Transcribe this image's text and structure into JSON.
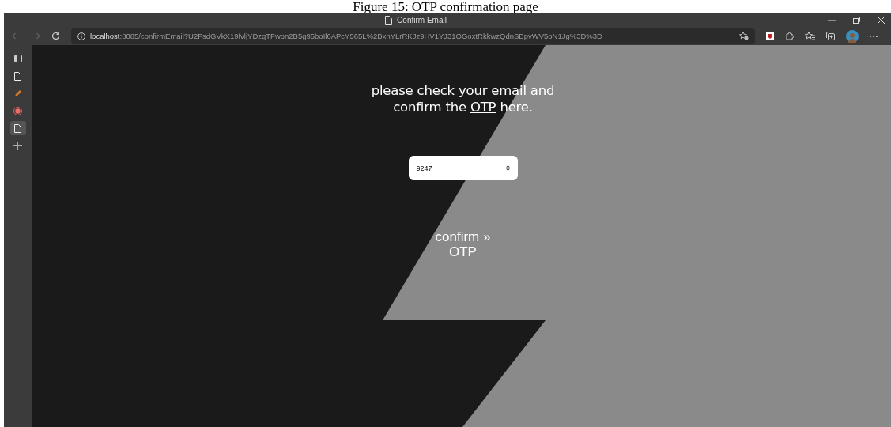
{
  "caption": "Figure 15: OTP confirmation page",
  "window": {
    "title": "Confirm Email"
  },
  "address_bar": {
    "host": "localhost",
    "path": ":8085/confirmEmail?U2FsdGVkX19fvljYDzqTFwon2B5g95boIl6APcY565L%2BxnYLrRKJz9HV1YJ31QGoxtRkkwzQdnSBpvWV5oN1Jg%3D%3D"
  },
  "sidebar": {
    "items": [
      {
        "kind": "tabs",
        "selected": false
      },
      {
        "kind": "page",
        "selected": false
      },
      {
        "kind": "pen",
        "selected": false
      },
      {
        "kind": "record",
        "selected": false
      },
      {
        "kind": "page",
        "selected": true
      },
      {
        "kind": "add",
        "selected": false
      }
    ]
  },
  "page": {
    "heading": "please check your email and\nconfirm the **OTP** here.",
    "otp_field": {
      "value": "9247"
    },
    "confirm_button": "confirm » OTP"
  }
}
